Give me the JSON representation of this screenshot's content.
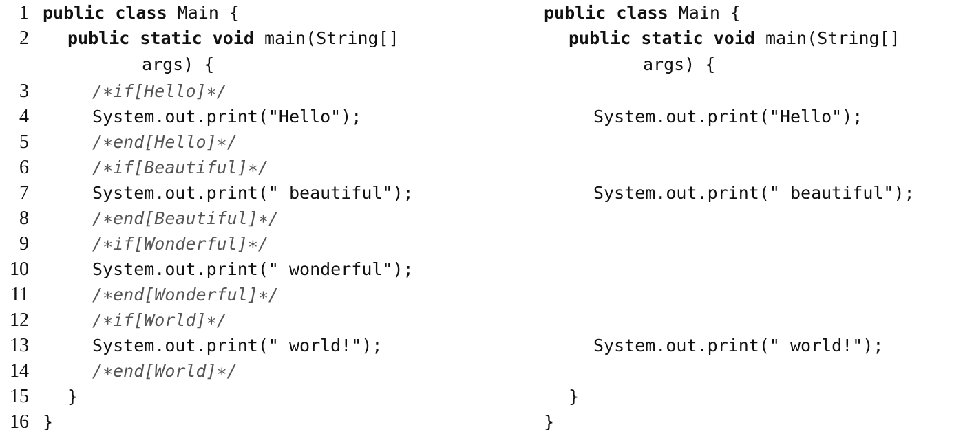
{
  "left": {
    "lines": [
      {
        "n": "1",
        "indent": 0,
        "parts": [
          {
            "t": "kw",
            "v": "public class"
          },
          {
            "t": "txt",
            "v": " Main {"
          }
        ]
      },
      {
        "n": "2",
        "indent": 1,
        "parts": [
          {
            "t": "kw",
            "v": "public static void"
          },
          {
            "t": "txt",
            "v": " main(String[]"
          }
        ]
      },
      {
        "n": "",
        "indent": 4,
        "cont": true,
        "parts": [
          {
            "t": "txt",
            "v": "args) {"
          }
        ]
      },
      {
        "n": "3",
        "indent": 2,
        "parts": [
          {
            "t": "comment",
            "v": "/∗if[Hello]∗/"
          }
        ]
      },
      {
        "n": "4",
        "indent": 2,
        "parts": [
          {
            "t": "txt",
            "v": "System.out.print(\"Hello\");"
          }
        ]
      },
      {
        "n": "5",
        "indent": 2,
        "parts": [
          {
            "t": "comment",
            "v": "/∗end[Hello]∗/"
          }
        ]
      },
      {
        "n": "6",
        "indent": 2,
        "parts": [
          {
            "t": "comment",
            "v": "/∗if[Beautiful]∗/"
          }
        ]
      },
      {
        "n": "7",
        "indent": 2,
        "parts": [
          {
            "t": "txt",
            "v": "System.out.print(\" beautiful\");"
          }
        ]
      },
      {
        "n": "8",
        "indent": 2,
        "parts": [
          {
            "t": "comment",
            "v": "/∗end[Beautiful]∗/"
          }
        ]
      },
      {
        "n": "9",
        "indent": 2,
        "parts": [
          {
            "t": "comment",
            "v": "/∗if[Wonderful]∗/"
          }
        ]
      },
      {
        "n": "10",
        "indent": 2,
        "parts": [
          {
            "t": "txt",
            "v": "System.out.print(\" wonderful\");"
          }
        ]
      },
      {
        "n": "11",
        "indent": 2,
        "parts": [
          {
            "t": "comment",
            "v": "/∗end[Wonderful]∗/"
          }
        ]
      },
      {
        "n": "12",
        "indent": 2,
        "parts": [
          {
            "t": "comment",
            "v": "/∗if[World]∗/"
          }
        ]
      },
      {
        "n": "13",
        "indent": 2,
        "parts": [
          {
            "t": "txt",
            "v": "System.out.print(\" world!\");"
          }
        ]
      },
      {
        "n": "14",
        "indent": 2,
        "parts": [
          {
            "t": "comment",
            "v": "/∗end[World]∗/"
          }
        ]
      },
      {
        "n": "15",
        "indent": 1,
        "parts": [
          {
            "t": "txt",
            "v": "}"
          }
        ]
      },
      {
        "n": "16",
        "indent": 0,
        "parts": [
          {
            "t": "txt",
            "v": "}"
          }
        ]
      }
    ]
  },
  "right": {
    "lines": [
      {
        "indent": 0,
        "parts": [
          {
            "t": "kw",
            "v": "public class"
          },
          {
            "t": "txt",
            "v": " Main {"
          }
        ]
      },
      {
        "indent": 1,
        "parts": [
          {
            "t": "kw",
            "v": "public static void"
          },
          {
            "t": "txt",
            "v": " main(String[]"
          }
        ]
      },
      {
        "indent": 4,
        "cont": true,
        "parts": [
          {
            "t": "txt",
            "v": "args) {"
          }
        ]
      },
      {
        "indent": 0,
        "parts": []
      },
      {
        "indent": 2,
        "parts": [
          {
            "t": "txt",
            "v": "System.out.print(\"Hello\");"
          }
        ]
      },
      {
        "indent": 0,
        "parts": []
      },
      {
        "indent": 0,
        "parts": []
      },
      {
        "indent": 2,
        "parts": [
          {
            "t": "txt",
            "v": "System.out.print(\" beautiful\");"
          }
        ]
      },
      {
        "indent": 0,
        "parts": []
      },
      {
        "indent": 0,
        "parts": []
      },
      {
        "indent": 0,
        "parts": []
      },
      {
        "indent": 0,
        "parts": []
      },
      {
        "indent": 0,
        "parts": []
      },
      {
        "indent": 2,
        "parts": [
          {
            "t": "txt",
            "v": "System.out.print(\" world!\");"
          }
        ]
      },
      {
        "indent": 0,
        "parts": []
      },
      {
        "indent": 1,
        "parts": [
          {
            "t": "txt",
            "v": "}"
          }
        ]
      },
      {
        "indent": 0,
        "parts": [
          {
            "t": "txt",
            "v": "}"
          }
        ]
      }
    ]
  }
}
